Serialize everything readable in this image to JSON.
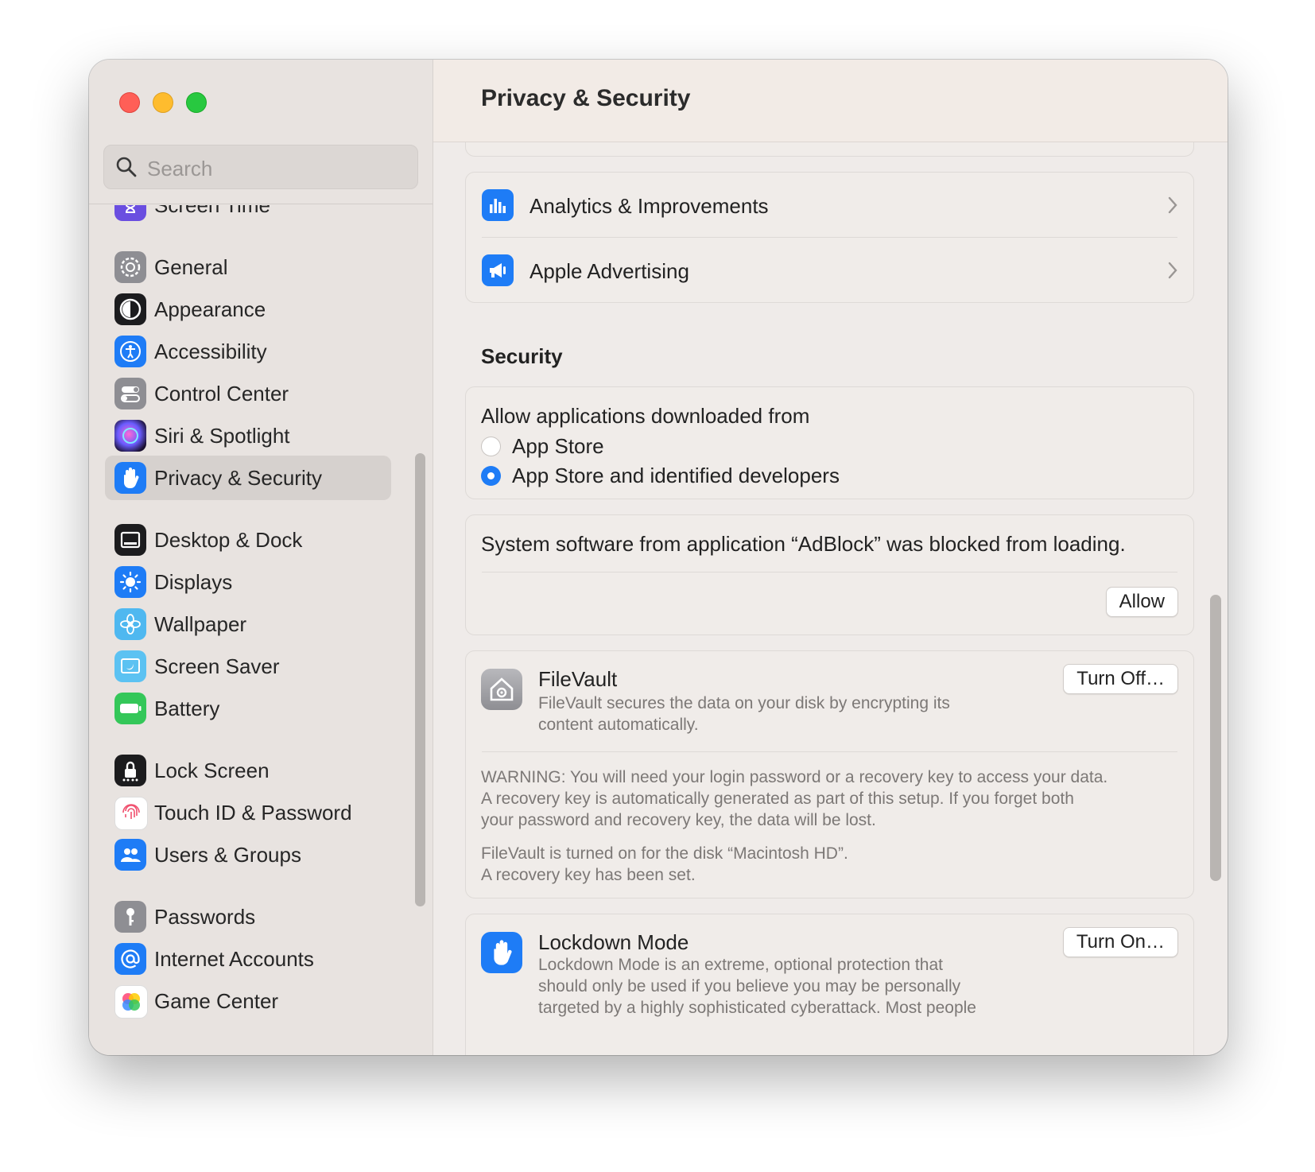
{
  "window": {
    "title": "Privacy & Security"
  },
  "search": {
    "placeholder": "Search"
  },
  "sidebar": {
    "items": [
      {
        "label": "Screen Time",
        "icon": "hourglass-icon",
        "color": "#6a4ee0"
      },
      {
        "label": "General",
        "icon": "gear-icon",
        "color": "#8e8e93"
      },
      {
        "label": "Appearance",
        "icon": "appearance-icon",
        "color": "#1c1c1e"
      },
      {
        "label": "Accessibility",
        "icon": "accessibility-icon",
        "color": "#1e7cf6"
      },
      {
        "label": "Control Center",
        "icon": "toggles-icon",
        "color": "#8e8e93"
      },
      {
        "label": "Siri & Spotlight",
        "icon": "siri-icon",
        "color": "#3a2a6a"
      },
      {
        "label": "Privacy & Security",
        "icon": "hand-icon",
        "color": "#1e7cf6",
        "selected": true
      },
      {
        "label": "Desktop & Dock",
        "icon": "dock-icon",
        "color": "#1c1c1e"
      },
      {
        "label": "Displays",
        "icon": "sun-icon",
        "color": "#1e7cf6"
      },
      {
        "label": "Wallpaper",
        "icon": "flower-icon",
        "color": "#4fb8f0"
      },
      {
        "label": "Screen Saver",
        "icon": "screensaver-icon",
        "color": "#5cc2f2"
      },
      {
        "label": "Battery",
        "icon": "battery-icon",
        "color": "#34c759"
      },
      {
        "label": "Lock Screen",
        "icon": "lock-icon",
        "color": "#1c1c1e"
      },
      {
        "label": "Touch ID & Password",
        "icon": "fingerprint-icon",
        "color": "#ffffff"
      },
      {
        "label": "Users & Groups",
        "icon": "users-icon",
        "color": "#1e7cf6"
      },
      {
        "label": "Passwords",
        "icon": "key-icon",
        "color": "#8e8e93"
      },
      {
        "label": "Internet Accounts",
        "icon": "at-icon",
        "color": "#1e7cf6"
      },
      {
        "label": "Game Center",
        "icon": "game-center-icon",
        "color": "#ffffff"
      }
    ]
  },
  "main": {
    "rows": [
      {
        "label": "Analytics & Improvements",
        "icon": "bar-chart-icon"
      },
      {
        "label": "Apple Advertising",
        "icon": "megaphone-icon"
      }
    ],
    "security_title": "Security",
    "allow_apps": {
      "label": "Allow applications downloaded from",
      "options": [
        "App Store",
        "App Store and identified developers"
      ],
      "selected": "App Store and identified developers"
    },
    "blocked": {
      "message": "System software from application “AdBlock” was blocked from loading.",
      "button": "Allow"
    },
    "filevault": {
      "title": "FileVault",
      "desc_line1": "FileVault secures the data on your disk by encrypting its",
      "desc_line2": "content automatically.",
      "button": "Turn Off…",
      "warning_line1": "WARNING: You will need your login password or a recovery key to access your data.",
      "warning_line2": "A recovery key is automatically generated as part of this setup. If you forget both",
      "warning_line3": "your password and recovery key, the data will be lost.",
      "status_line1": "FileVault is turned on for the disk “Macintosh HD”.",
      "status_line2": "A recovery key has been set."
    },
    "lockdown": {
      "title": "Lockdown Mode",
      "desc_line1": "Lockdown Mode is an extreme, optional protection that",
      "desc_line2": "should only be used if you believe you may be personally",
      "desc_line3": "targeted by a highly sophisticated cyberattack. Most people",
      "button": "Turn On…"
    }
  },
  "colors": {
    "accent": "#1e7cf6"
  }
}
